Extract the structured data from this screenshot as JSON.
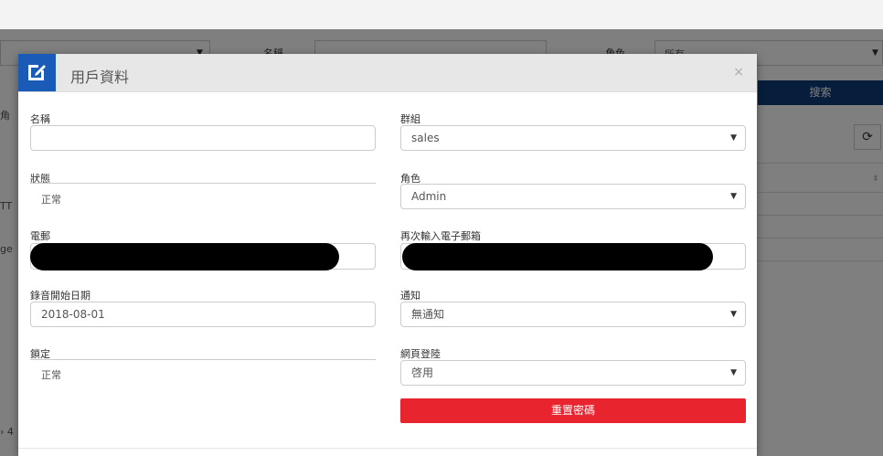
{
  "background": {
    "field1_label": "名稱",
    "field2_label": "角色",
    "field2_value": "所有",
    "search_button": "搜索",
    "left_fragments": [
      "部",
      "角",
      "TT",
      "ge",
      "› 4"
    ]
  },
  "modal": {
    "title": "用戶資料",
    "close": "×",
    "left": {
      "name_label": "名稱",
      "name_value": "",
      "status_label": "狀態",
      "status_value": "正常",
      "email_label": "電郵",
      "record_date_label": "錄音開始日期",
      "record_date_value": "2018-08-01",
      "lock_label": "鎖定",
      "lock_value": "正常"
    },
    "right": {
      "group_label": "群組",
      "group_value": "sales",
      "role_label": "角色",
      "role_value": "Admin",
      "email_confirm_label": "再次輸入電子郵箱",
      "notify_label": "通知",
      "notify_value": "無通知",
      "web_login_label": "網頁登陸",
      "web_login_value": "啓用",
      "reset_password_button": "重置密碼"
    }
  },
  "colors": {
    "accent_blue": "#1a5bb7",
    "search_blue": "#0d3c78",
    "danger_red": "#e8242f"
  }
}
